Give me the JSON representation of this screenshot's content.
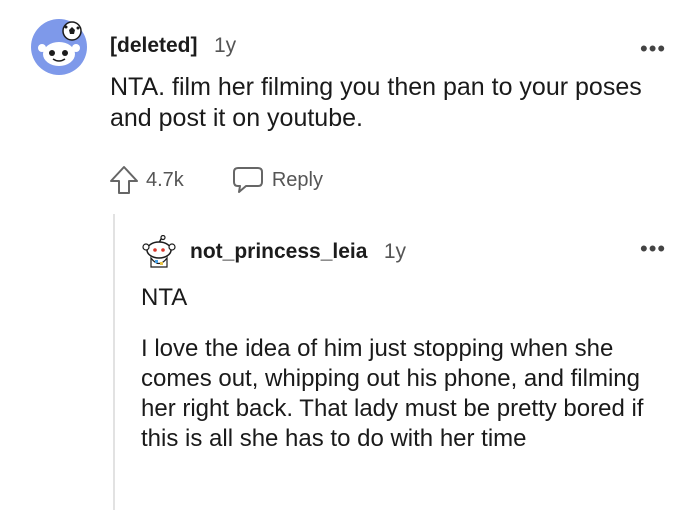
{
  "top_comment": {
    "username": "[deleted]",
    "age": "1y",
    "more_label": "•••",
    "body": "NTA. film her filming you then pan to your poses and post it on youtube.",
    "upvotes": "4.7k",
    "reply_label": "Reply"
  },
  "reply_comment": {
    "username": "not_princess_leia",
    "age": "1y",
    "more_label": "•••",
    "paragraph1": "NTA",
    "paragraph2": "I love the idea of him just stopping when she comes out, whipping out his phone, and filming her right back. That lady must be pretty bored if this is all she has to do with her time"
  },
  "colors": {
    "avatar_bg": "#7e99ea",
    "thread_line": "#e2e2e2",
    "text": "#1c1c1c",
    "muted": "#555555"
  }
}
